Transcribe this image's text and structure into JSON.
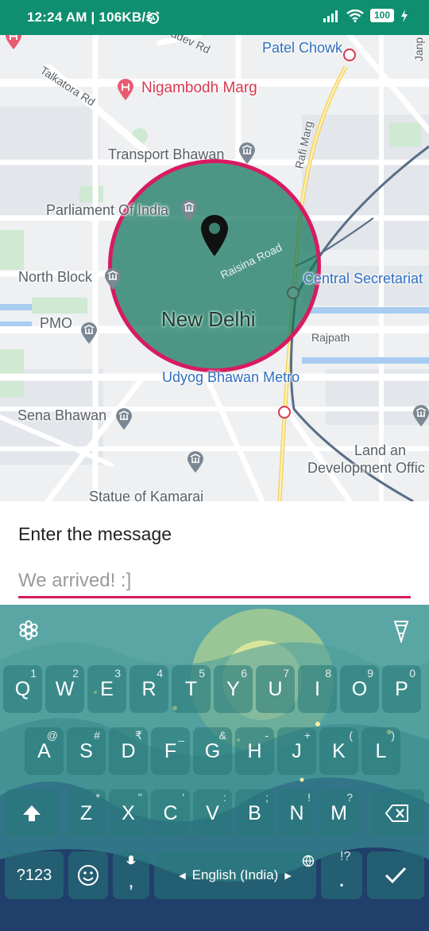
{
  "status_bar": {
    "time": "12:24 AM",
    "speed": "106KB/s",
    "battery": "100",
    "icons": [
      "alarm-icon",
      "signal-icon",
      "wifi-icon",
      "battery-icon",
      "charging-icon"
    ]
  },
  "map": {
    "labels": {
      "adev_rd": "adev Rd",
      "patel_chowk": "Patel Chowk",
      "janp": "Janp",
      "talkatora_rd": "Talkatora Rd",
      "nigambodh_marg": "Nigambodh Marg",
      "transport_bhawan": "Transport Bhawan",
      "rafi_marg": "Rafi Marg",
      "parliament": "Parliament Of India",
      "raisina_road": "Raisina Road",
      "north_block": "North Block",
      "central_secretariat": "Central Secretariat",
      "pmo": "PMO",
      "new_delhi": "New Delhi",
      "rajpath": "Rajpath",
      "udyog_bhawan": "Udyog Bhawan Metro",
      "sena_bhawan": "Sena Bhawan",
      "land_and": "Land an",
      "development": "Development Offic",
      "statue": "Statue of Kamarai"
    },
    "geofence_color": "#d81b60"
  },
  "message": {
    "title": "Enter the message",
    "placeholder": "We arrived! :]"
  },
  "keyboard": {
    "row1": [
      {
        "k": "Q",
        "s": "1"
      },
      {
        "k": "W",
        "s": "2"
      },
      {
        "k": "E",
        "s": "3"
      },
      {
        "k": "R",
        "s": "4"
      },
      {
        "k": "T",
        "s": "5"
      },
      {
        "k": "Y",
        "s": "6"
      },
      {
        "k": "U",
        "s": "7"
      },
      {
        "k": "I",
        "s": "8"
      },
      {
        "k": "O",
        "s": "9"
      },
      {
        "k": "P",
        "s": "0"
      }
    ],
    "row2": [
      {
        "k": "A",
        "s": "@"
      },
      {
        "k": "S",
        "s": "#"
      },
      {
        "k": "D",
        "s": "₹"
      },
      {
        "k": "F",
        "s": "_"
      },
      {
        "k": "G",
        "s": "&"
      },
      {
        "k": "H",
        "s": "-"
      },
      {
        "k": "J",
        "s": "+"
      },
      {
        "k": "K",
        "s": "("
      },
      {
        "k": "L",
        "s": ")"
      }
    ],
    "row3": [
      {
        "k": "Z",
        "s": "*"
      },
      {
        "k": "X",
        "s": "\""
      },
      {
        "k": "C",
        "s": "'"
      },
      {
        "k": "V",
        "s": ":"
      },
      {
        "k": "B",
        "s": ";"
      },
      {
        "k": "N",
        "s": "!"
      },
      {
        "k": "M",
        "s": "?"
      }
    ],
    "symbols_label": "?123",
    "comma": ",",
    "space_label": "English (India)",
    "period": ".",
    "period_sup": "!?",
    "accent": "#d81b60"
  }
}
